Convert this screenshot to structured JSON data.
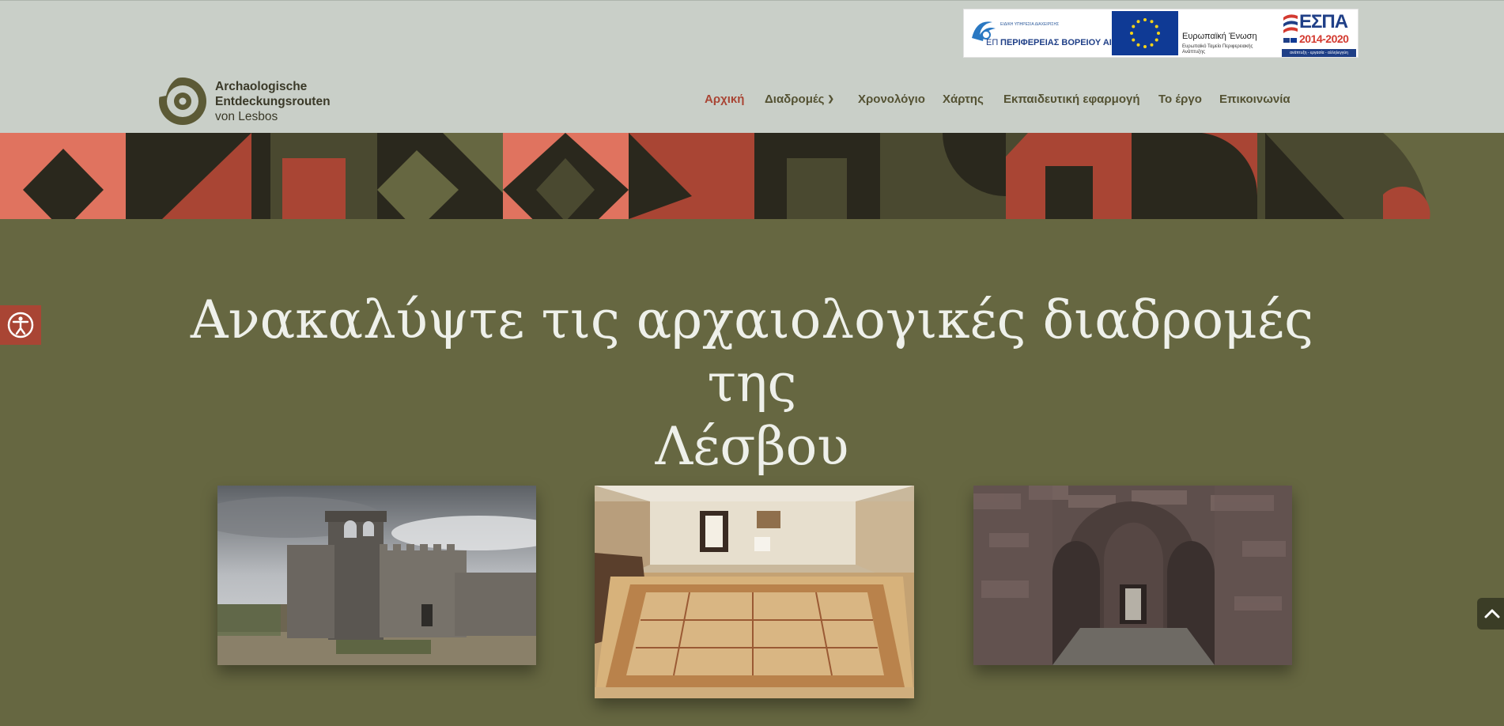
{
  "sponsors": {
    "region_small": "ΕΙΔΙΚΗ ΥΠΗΡΕΣΙΑ ΔΙΑΧΕΙΡΙΣΗΣ",
    "region_big": "ΠΕΡΙΦΕΡΕΙΑΣ ΒΟΡΕΙΟΥ ΑΙΓΑΙΟΥ",
    "region_prefix": "ΕΠ",
    "eu_title": "Ευρωπαϊκή Ένωση",
    "eu_subtitle": "Ευρωπαϊκό Ταμείο Περιφερειακής Ανάπτυξης",
    "espa_title": "ΕΣΠΑ",
    "espa_years": "2014-2020",
    "espa_slogan": "ανάπτυξη - εργασία - αλληλεγγύη"
  },
  "logo": {
    "line1": "Archaologische",
    "line2": "Entdeckungsrouten",
    "line3": "von Lesbos"
  },
  "nav": {
    "items": [
      {
        "label": "Αρχική",
        "active": true
      },
      {
        "label": "Διαδρομές",
        "has_dropdown": true
      },
      {
        "label": "Χρονολόγιο"
      },
      {
        "label": "Χάρτης"
      },
      {
        "label": "Εκπαιδευτική εφαρμογή"
      },
      {
        "label": "Το έργο"
      },
      {
        "label": "Επικοινωνία"
      }
    ],
    "languages": [
      "en-flag-icon",
      "de-flag-icon"
    ]
  },
  "hero": {
    "title_line1": "Ανακαλύψτε τις αρχαιολογικές διαδρομές της",
    "title_line2": "Λέσβου"
  },
  "cards": [
    {
      "subject": "castle"
    },
    {
      "subject": "museum-mosaic"
    },
    {
      "subject": "stone-archway"
    }
  ],
  "floating": {
    "accessibility_icon": "accessibility-icon",
    "scroll_top_icon": "chevron-up-icon"
  },
  "colors": {
    "header_bg": "#c9cfc8",
    "page_bg": "#666741",
    "accent": "#a94534",
    "nav_text": "#545233",
    "coral": "#e0735f",
    "dark": "#2a281d",
    "olive_dark": "#4a4930"
  }
}
